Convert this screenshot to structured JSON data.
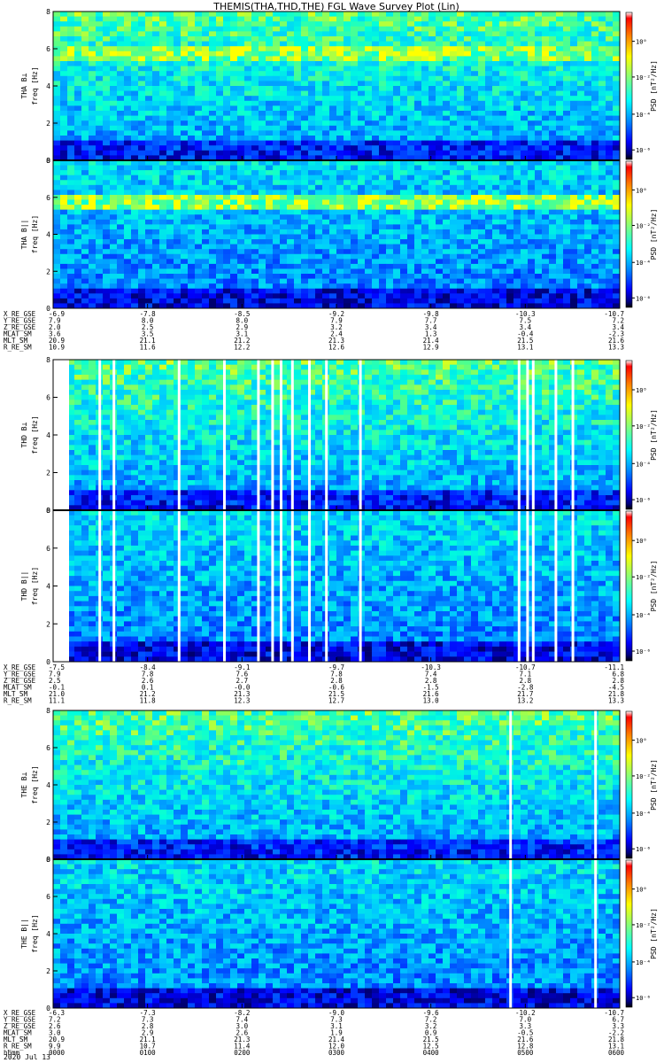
{
  "title": "THEMIS(THA,THD,THE) FGL Wave Survey Plot (Lin)",
  "date_label": "2020 Jul 13",
  "colorbar": {
    "label": "PSD [nT²/Hz]",
    "gradient": [
      "#ffffff",
      "#ff0000",
      "#ff8000",
      "#ffff00",
      "#80ff80",
      "#00ffff",
      "#0080ff",
      "#0000ff",
      "#000080",
      "#000000"
    ],
    "ticks_bl": [
      {
        "label": "10⁰",
        "frac": 0.2
      },
      {
        "label": "10⁻²",
        "frac": 0.44
      },
      {
        "label": "10⁻⁴",
        "frac": 0.69
      },
      {
        "label": "10⁻⁶",
        "frac": 0.93
      }
    ],
    "ticks_bll": [
      {
        "label": "10⁰",
        "frac": 0.2
      },
      {
        "label": "10⁻²",
        "frac": 0.44
      },
      {
        "label": "10⁻⁴",
        "frac": 0.69
      },
      {
        "label": "10⁻⁶",
        "frac": 0.93
      }
    ]
  },
  "x_ticks": [
    "0000",
    "0100",
    "0200",
    "0300",
    "0400",
    "0500",
    "0600"
  ],
  "chart_data": [
    {
      "type": "heatmap",
      "probe": "THA",
      "panels": [
        {
          "ylabel_top": "THA B⊥",
          "ylabel": "freq [Hz]",
          "ylim": [
            0,
            8
          ],
          "yticks": [
            "0",
            "2",
            "4",
            "6",
            "8"
          ],
          "line_freq": 5.8,
          "variant": "perp"
        },
        {
          "ylabel_top": "THA B||",
          "ylabel": "freq [Hz]",
          "ylim": [
            0,
            8
          ],
          "yticks": [
            "0",
            "2",
            "4",
            "6",
            "8"
          ],
          "line_freq": 5.8,
          "variant": "par"
        }
      ],
      "gaps": [],
      "ephemeris": [
        {
          "label": "X_RE_GSE",
          "values": [
            "-6.9",
            "-7.8",
            "-8.5",
            "-9.2",
            "-9.8",
            "-10.3",
            "-10.7"
          ]
        },
        {
          "label": "Y_RE_GSE",
          "values": [
            "7.9",
            "8.0",
            "8.0",
            "7.9",
            "7.7",
            "7.5",
            "7.2"
          ]
        },
        {
          "label": "Z_RE_GSE",
          "values": [
            "2.0",
            "2.5",
            "2.9",
            "3.2",
            "3.4",
            "3.4",
            "3.4"
          ]
        },
        {
          "label": "MLAT_SM",
          "values": [
            "3.6",
            "3.5",
            "3.1",
            "2.4",
            "1.3",
            "-0.4",
            "-2.3"
          ]
        },
        {
          "label": "MLT_SM",
          "values": [
            "20.9",
            "21.1",
            "21.2",
            "21.3",
            "21.4",
            "21.5",
            "21.6"
          ]
        },
        {
          "label": "R_RE_SM",
          "values": [
            "10.9",
            "11.6",
            "12.2",
            "12.6",
            "12.9",
            "13.1",
            "13.3"
          ]
        }
      ]
    },
    {
      "type": "heatmap",
      "probe": "THD",
      "panels": [
        {
          "ylabel_top": "THD B⊥",
          "ylabel": "freq [Hz]",
          "ylim": [
            0,
            8
          ],
          "yticks": [
            "0",
            "2",
            "4",
            "6",
            "8"
          ],
          "line_freq": 0,
          "variant": "perp"
        },
        {
          "ylabel_top": "THD B||",
          "ylabel": "freq [Hz]",
          "ylim": [
            0,
            8
          ],
          "yticks": [
            "0",
            "2",
            "4",
            "6",
            "8"
          ],
          "line_freq": 0,
          "variant": "par"
        }
      ],
      "gaps": [
        0.0,
        0.08,
        0.105,
        0.22,
        0.3,
        0.36,
        0.385,
        0.4,
        0.42,
        0.45,
        0.48,
        0.54,
        0.82,
        0.835,
        0.845,
        0.885,
        0.915
      ],
      "ephemeris": [
        {
          "label": "X_RE_GSE",
          "values": [
            "-7.5",
            "-8.4",
            "-9.1",
            "-9.7",
            "-10.3",
            "-10.7",
            "-11.1"
          ]
        },
        {
          "label": "Y_RE_GSE",
          "values": [
            "7.9",
            "7.8",
            "7.6",
            "7.8",
            "7.4",
            "7.1",
            "6.8"
          ]
        },
        {
          "label": "Z_RE_GSE",
          "values": [
            "2.5",
            "2.6",
            "2.7",
            "2.8",
            "2.8",
            "2.8",
            "2.8"
          ]
        },
        {
          "label": "MLAT_SM",
          "values": [
            "-0.1",
            "0.1",
            "-0.0",
            "-0.6",
            "-1.5",
            "-2.8",
            "-4.5"
          ]
        },
        {
          "label": "MLT_SM",
          "values": [
            "21.0",
            "21.2",
            "21.3",
            "21.5",
            "21.6",
            "21.7",
            "21.8"
          ]
        },
        {
          "label": "R_RE_SM",
          "values": [
            "11.1",
            "11.8",
            "12.3",
            "12.7",
            "13.0",
            "13.2",
            "13.3"
          ]
        }
      ]
    },
    {
      "type": "heatmap",
      "probe": "THE",
      "panels": [
        {
          "ylabel_top": "THE B⊥",
          "ylabel": "freq [Hz]",
          "ylim": [
            0,
            8
          ],
          "yticks": [
            "0",
            "2",
            "4",
            "6",
            "8"
          ],
          "line_freq": 0,
          "variant": "perp"
        },
        {
          "ylabel_top": "THE B||",
          "ylabel": "freq [Hz]",
          "ylim": [
            0,
            8
          ],
          "yticks": [
            "0",
            "2",
            "4",
            "6",
            "8"
          ],
          "line_freq": 0,
          "variant": "par"
        }
      ],
      "gaps": [
        0.805,
        0.955
      ],
      "ephemeris": [
        {
          "label": "X_RE_GSE",
          "values": [
            "-6.3",
            "-7.3",
            "-8.2",
            "-9.0",
            "-9.6",
            "-10.2",
            "-10.7"
          ]
        },
        {
          "label": "Y_RE_GSE",
          "values": [
            "7.2",
            "7.3",
            "7.4",
            "7.3",
            "7.2",
            "7.0",
            "6.7"
          ]
        },
        {
          "label": "Z_RE_GSE",
          "values": [
            "2.6",
            "2.8",
            "3.0",
            "3.1",
            "3.2",
            "3.3",
            "3.3"
          ]
        },
        {
          "label": "MLAT_SM",
          "values": [
            "3.0",
            "2.9",
            "2.6",
            "1.9",
            "0.9",
            "-0.5",
            "-2.2"
          ]
        },
        {
          "label": "MLT_SM",
          "values": [
            "20.9",
            "21.1",
            "21.3",
            "21.4",
            "21.5",
            "21.6",
            "21.8"
          ]
        },
        {
          "label": "R_RE_SM",
          "values": [
            "9.9",
            "10.7",
            "11.4",
            "12.0",
            "12.5",
            "12.8",
            "13.1"
          ]
        },
        {
          "label": "hhmm",
          "values": [
            "0000",
            "0100",
            "0200",
            "0300",
            "0400",
            "0500",
            "0600"
          ]
        }
      ]
    }
  ]
}
